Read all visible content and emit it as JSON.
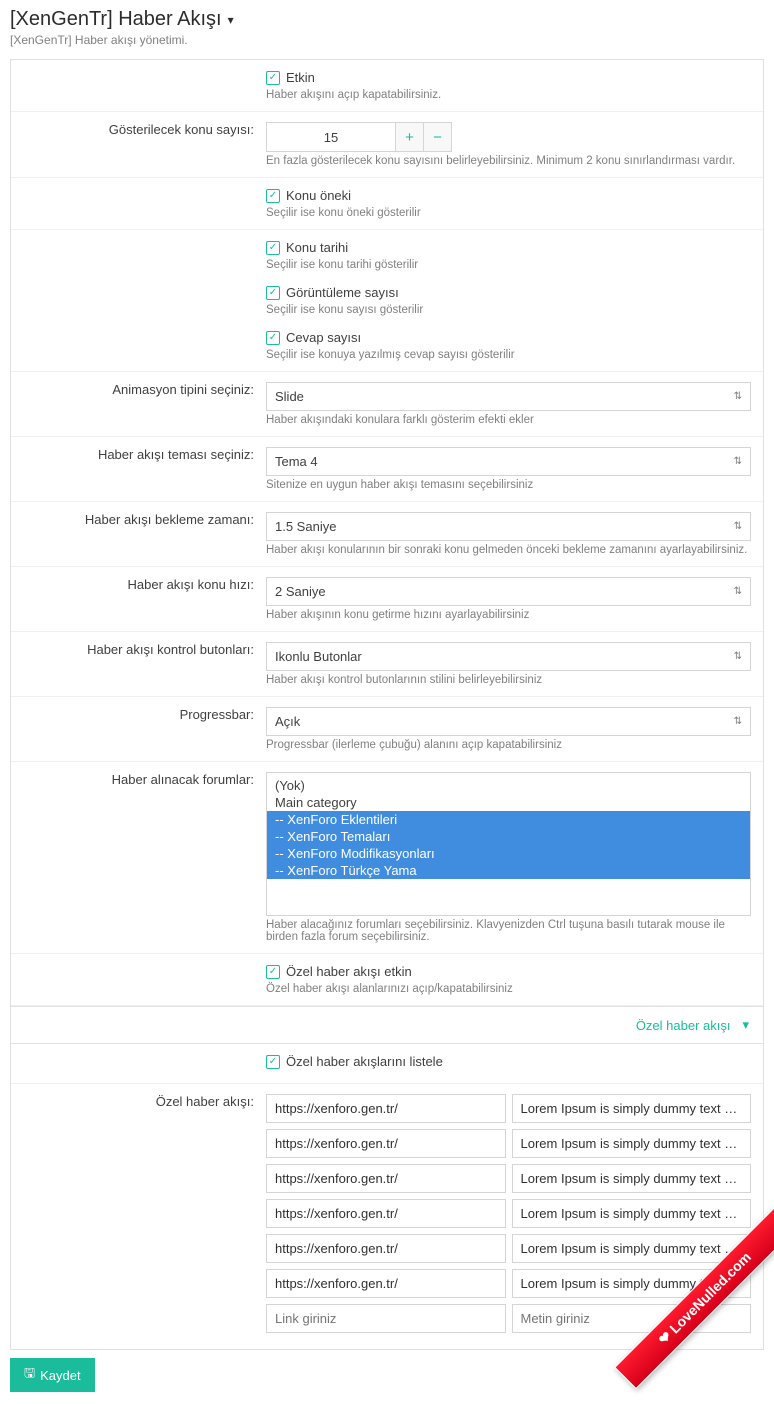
{
  "header": {
    "title": "[XenGenTr] Haber Akışı",
    "subtitle": "[XenGenTr] Haber akışı yönetimi."
  },
  "etkin": {
    "label": "Etkin",
    "hint": "Haber akışını açıp kapatabilirsiniz."
  },
  "konu_sayisi": {
    "label": "Gösterilecek konu sayısı:",
    "value": "15",
    "hint": "En fazla gösterilecek konu sayısını belirleyebilirsiniz. Minimum 2 konu sınırlandırması vardır."
  },
  "konu_oneki": {
    "label": "Konu öneki",
    "hint": "Seçilir ise konu öneki gösterilir"
  },
  "konu_tarihi": {
    "label": "Konu tarihi",
    "hint": "Seçilir ise konu tarihi gösterilir"
  },
  "goruntuleme": {
    "label": "Görüntüleme sayısı",
    "hint": "Seçilir ise konu sayısı gösterilir"
  },
  "cevap": {
    "label": "Cevap sayısı",
    "hint": "Seçilir ise konuya yazılmış cevap sayısı gösterilir"
  },
  "animasyon": {
    "label": "Animasyon tipini seçiniz:",
    "value": "Slide",
    "hint": "Haber akışındaki konulara farklı gösterim efekti ekler"
  },
  "tema": {
    "label": "Haber akışı teması seçiniz:",
    "value": "Tema 4",
    "hint": "Sitenize en uygun haber akışı temasını seçebilirsiniz"
  },
  "bekleme": {
    "label": "Haber akışı bekleme zamanı:",
    "value": "1.5 Saniye",
    "hint": "Haber akışı konularının bir sonraki konu gelmeden önceki bekleme zamanını ayarlayabilirsiniz."
  },
  "hiz": {
    "label": "Haber akışı konu hızı:",
    "value": "2 Saniye",
    "hint": "Haber akışının konu getirme hızını ayarlayabilirsiniz"
  },
  "kontrol": {
    "label": "Haber akışı kontrol butonları:",
    "value": "Ikonlu Butonlar",
    "hint": "Haber akışı kontrol butonlarının stilini belirleyebilirsiniz"
  },
  "progressbar": {
    "label": "Progressbar:",
    "value": "Açık",
    "hint": "Progressbar (ilerleme çubuğu) alanını açıp kapatabilirsiniz"
  },
  "forumlar": {
    "label": "Haber alınacak forumlar:",
    "items": [
      {
        "text": "(Yok)",
        "selected": false
      },
      {
        "text": "Main category",
        "selected": false
      },
      {
        "text": "-- XenForo Eklentileri",
        "selected": true
      },
      {
        "text": "-- XenForo Temaları",
        "selected": true
      },
      {
        "text": "-- XenForo Modifikasyonları",
        "selected": true
      },
      {
        "text": "-- XenForo Türkçe Yama",
        "selected": true
      }
    ],
    "hint": "Haber alacağınız forumları seçebilirsiniz. Klavyenizden Ctrl tuşuna basılı tutarak mouse ile birden fazla forum seçebilirsiniz."
  },
  "ozel_etkin": {
    "label": "Özel haber akışı etkin",
    "hint": "Özel haber akışı alanlarınızı açıp/kapatabilirsiniz"
  },
  "section": {
    "title": "Özel haber akışı"
  },
  "listele": {
    "label": "Özel haber akışlarını listele"
  },
  "ozel": {
    "label": "Özel haber akışı:",
    "rows": [
      {
        "url": "https://xenforo.gen.tr/",
        "text": "Lorem Ipsum is simply dummy text of the printing a"
      },
      {
        "url": "https://xenforo.gen.tr/",
        "text": "Lorem Ipsum is simply dummy text of the printing a"
      },
      {
        "url": "https://xenforo.gen.tr/",
        "text": "Lorem Ipsum is simply dummy text of the prin"
      },
      {
        "url": "https://xenforo.gen.tr/",
        "text": "Lorem Ipsum is simply dummy text of th"
      },
      {
        "url": "https://xenforo.gen.tr/",
        "text": "Lorem Ipsum is simply dummy text of the printing a"
      },
      {
        "url": "https://xenforo.gen.tr/",
        "text": "Lorem Ipsum is simply dummy text of the printing a"
      }
    ],
    "placeholder_url": "Link giriniz",
    "placeholder_text": "Metin giriniz"
  },
  "save": "Kaydet",
  "ribbon": "LoveNulled.com"
}
